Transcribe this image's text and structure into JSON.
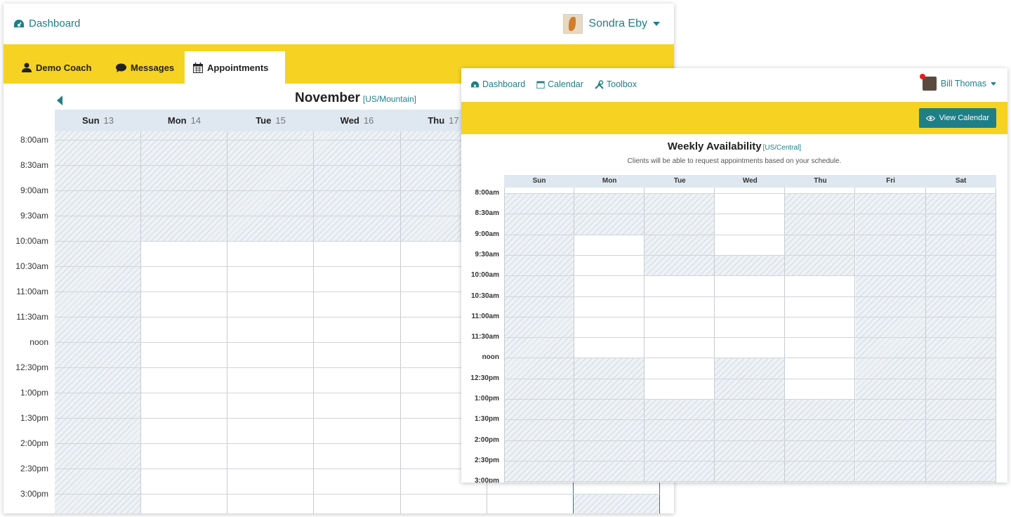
{
  "back_window": {
    "nav": {
      "brand": "Dashboard",
      "user": "Sondra Eby"
    },
    "tabs": [
      {
        "label": "Demo Coach",
        "icon": "user-icon"
      },
      {
        "label": "Messages",
        "icon": "chat-icon"
      },
      {
        "label": "Appointments",
        "icon": "calendar-icon",
        "active": true
      }
    ],
    "calendar": {
      "month": "November",
      "timezone": "[US/Mountain]",
      "days": [
        {
          "name": "Sun",
          "date": "13"
        },
        {
          "name": "Mon",
          "date": "14"
        },
        {
          "name": "Tue",
          "date": "15"
        },
        {
          "name": "Wed",
          "date": "16"
        },
        {
          "name": "Thu",
          "date": "17"
        },
        {
          "name": "",
          "date": ""
        },
        {
          "name": "",
          "date": ""
        }
      ],
      "times": [
        "8:00am",
        "8:30am",
        "9:00am",
        "9:30am",
        "10:00am",
        "10:30am",
        "11:00am",
        "11:30am",
        "noon",
        "12:30pm",
        "1:00pm",
        "1:30pm",
        "2:00pm",
        "2:30pm",
        "3:00pm"
      ]
    }
  },
  "front_window": {
    "nav": {
      "dashboard": "Dashboard",
      "calendar": "Calendar",
      "toolbox": "Toolbox",
      "user": "Bill Thomas"
    },
    "view_calendar_label": "View Calendar",
    "title": "Weekly Availability",
    "timezone": "[US/Central]",
    "subtitle": "Clients will be able to request appointments based on your schedule.",
    "days": [
      "Sun",
      "Mon",
      "Tue",
      "Wed",
      "Thu",
      "Fri",
      "Sat"
    ],
    "times": [
      "8:00am",
      "8:30am",
      "9:00am",
      "9:30am",
      "10:00am",
      "10:30am",
      "11:00am",
      "11:30am",
      "noon",
      "12:30pm",
      "1:00pm",
      "1:30pm",
      "2:00pm",
      "2:30pm",
      "3:00pm"
    ]
  },
  "colors": {
    "accent": "#1e7f86",
    "yellow": "#f6d223",
    "header_bg": "#dfe8f0",
    "unavailable": "#eef2f5"
  }
}
